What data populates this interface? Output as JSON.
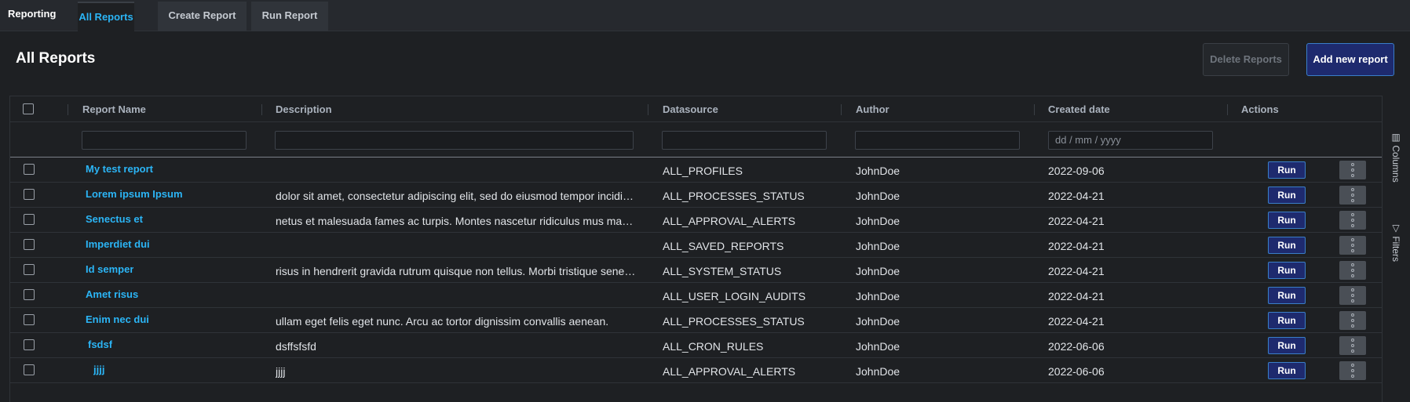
{
  "app": {
    "title": "Reporting"
  },
  "tabs": [
    {
      "label": "All Reports",
      "active": true
    },
    {
      "label": "Create Report",
      "active": false
    },
    {
      "label": "Run Report",
      "active": false
    }
  ],
  "page": {
    "title": "All Reports"
  },
  "toolbar": {
    "delete_label": "Delete Reports",
    "add_label": "Add new report"
  },
  "table": {
    "columns": [
      "Report Name",
      "Description",
      "Datasource",
      "Author",
      "Created date",
      "Actions"
    ],
    "date_placeholder": "dd / mm / yyyy",
    "run_label": "Run",
    "rows": [
      {
        "name": "My test report",
        "description": "",
        "datasource": "ALL_PROFILES",
        "author": "JohnDoe",
        "created": "2022-09-06"
      },
      {
        "name": "Lorem ipsum Ipsum",
        "description": "dolor sit amet, consectetur adipiscing elit, sed do eiusmod tempor incidi…",
        "datasource": "ALL_PROCESSES_STATUS",
        "author": "JohnDoe",
        "created": "2022-04-21"
      },
      {
        "name": "Senectus et",
        "description": "netus et malesuada fames ac turpis. Montes nascetur ridiculus mus ma…",
        "datasource": "ALL_APPROVAL_ALERTS",
        "author": "JohnDoe",
        "created": "2022-04-21"
      },
      {
        "name": "Imperdiet dui",
        "description": "",
        "datasource": "ALL_SAVED_REPORTS",
        "author": "JohnDoe",
        "created": "2022-04-21"
      },
      {
        "name": "Id semper",
        "description": "risus in hendrerit gravida rutrum quisque non tellus. Morbi tristique sene…",
        "datasource": "ALL_SYSTEM_STATUS",
        "author": "JohnDoe",
        "created": "2022-04-21"
      },
      {
        "name": "Amet risus",
        "description": "",
        "datasource": "ALL_USER_LOGIN_AUDITS",
        "author": "JohnDoe",
        "created": "2022-04-21"
      },
      {
        "name": "Enim nec dui",
        "description": "ullam eget felis eget nunc. Arcu ac tortor dignissim convallis aenean.",
        "datasource": "ALL_PROCESSES_STATUS",
        "author": "JohnDoe",
        "created": "2022-04-21"
      },
      {
        "name": "fsdsf",
        "description": "dsffsfsfd",
        "datasource": "ALL_CRON_RULES",
        "author": "JohnDoe",
        "created": "2022-06-06"
      },
      {
        "name": "jjjj",
        "description": "jjjj",
        "datasource": "ALL_APPROVAL_ALERTS",
        "author": "JohnDoe",
        "created": "2022-06-06"
      }
    ]
  },
  "side_panel": {
    "columns_label": "Columns",
    "filters_label": "Filters"
  },
  "icons": {
    "columns": "columns-icon",
    "filters": "filter-icon",
    "more": "more-vertical-icon"
  },
  "colors": {
    "accent": "#2bb5f6",
    "primary_button": "#1e2a6e",
    "background": "#1e2023"
  }
}
